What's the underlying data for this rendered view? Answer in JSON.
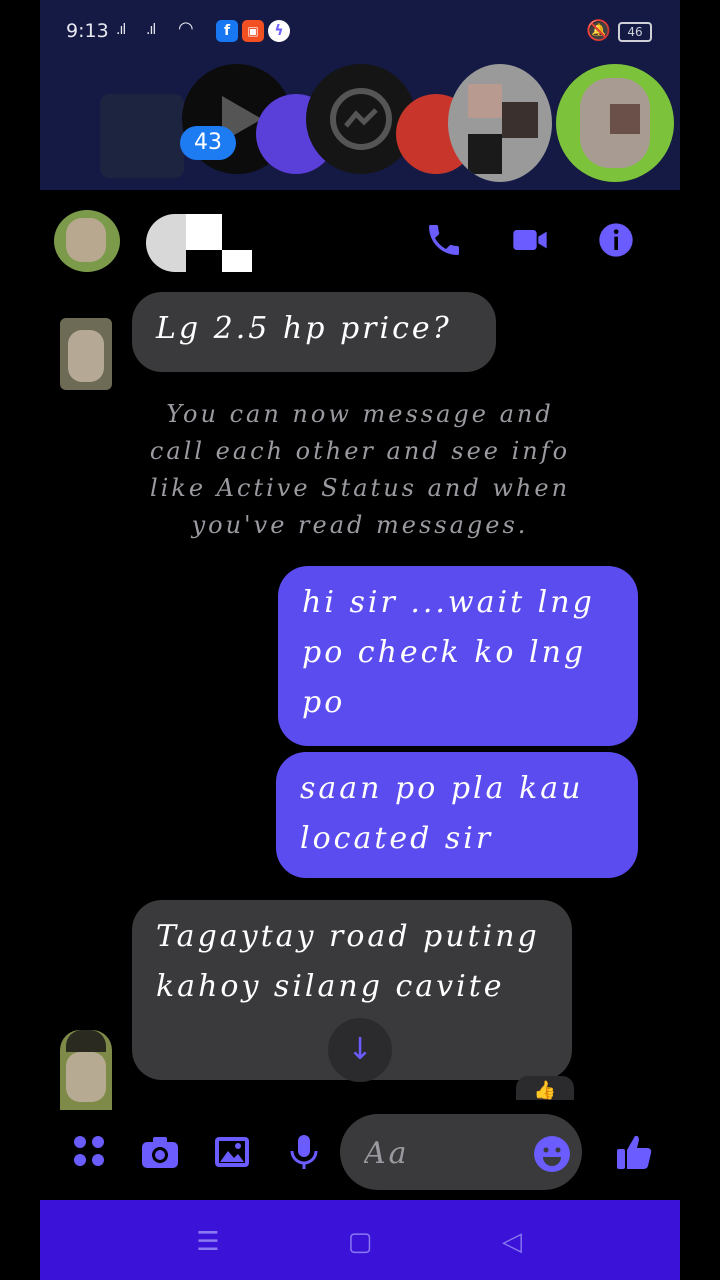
{
  "status_bar": {
    "time": "9:13",
    "battery": "46",
    "app_icons": [
      "facebook-icon",
      "shop-icon",
      "messenger-icon"
    ]
  },
  "chat_heads": {
    "badge_count": "43"
  },
  "messages": [
    {
      "id": "m1",
      "direction": "incoming",
      "text": "Lg 2.5 hp price?"
    },
    {
      "id": "m3",
      "direction": "outgoing",
      "text": "hi sir ...wait lng po check ko lng po"
    },
    {
      "id": "m4",
      "direction": "outgoing",
      "text": "saan po pla kau located sir"
    },
    {
      "id": "m5",
      "direction": "incoming",
      "text": "Tagaytay road puting kahoy silang cavite"
    }
  ],
  "system_notice": "You can now message and call each other and see info like Active Status and when you've read messages.",
  "composer": {
    "placeholder": "Aa"
  },
  "colors": {
    "accent": "#5b4cf0",
    "incoming_bubble": "#3a3a3c",
    "navbar": "#3a12d8",
    "header_bar": "#141a44"
  }
}
